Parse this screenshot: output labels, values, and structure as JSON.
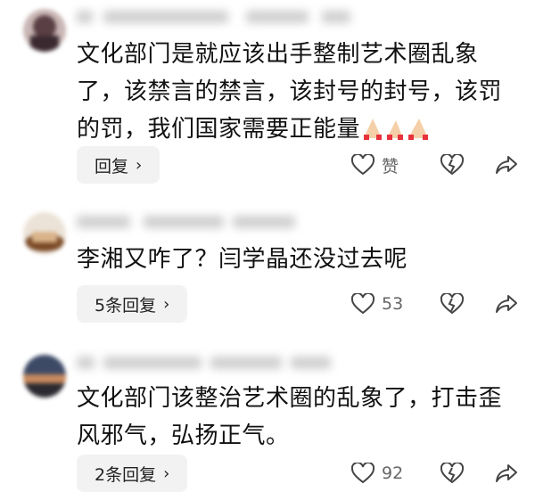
{
  "comments": [
    {
      "text_line1": "文化部门是就应该出手整制艺术圈乱象",
      "text_line2": "了，该禁言的禁言，该封号的封号，该罚",
      "text_line3": "的罚，我们国家需要正能量",
      "reply_label": "回复",
      "like_label": "赞",
      "avatar_colors": [
        "#5a3f44",
        "#c9b6b4"
      ]
    },
    {
      "text_line1": "李湘又咋了？闫学晶还没过去呢",
      "reply_label": "5条回复",
      "like_label": "53",
      "avatar_colors": [
        "#7a4a26",
        "#d9b38a"
      ]
    },
    {
      "text_line1": "文化部门该整治艺术圈的乱象了，打击歪",
      "text_line2": "风邪气，弘扬正气。",
      "reply_label": "2条回复",
      "like_label": "92",
      "avatar_colors": [
        "#3d4a66",
        "#c98a5e"
      ]
    }
  ],
  "icons": {
    "like": "heart-outline-icon",
    "dislike": "broken-heart-icon",
    "share": "share-arrow-icon",
    "chevron": "chevron-right-icon"
  },
  "colors": {
    "text": "#111111",
    "muted": "#666666",
    "button_bg": "#f2f2f2",
    "emoji_red": "#e8323c"
  }
}
